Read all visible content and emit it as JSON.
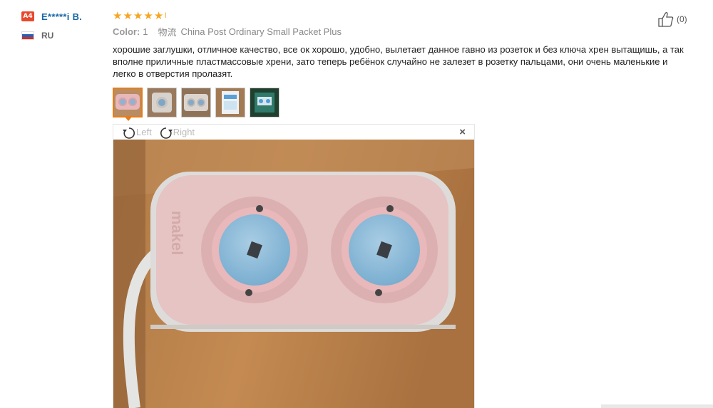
{
  "user": {
    "level_badge": "A4",
    "name": "E*****i B.",
    "country_code": "RU"
  },
  "rating": {
    "stars": 5,
    "max": 5
  },
  "info": {
    "color_label": "Color:",
    "color_value": "1",
    "shipping_label": "物流",
    "shipping_value": "China Post Ordinary Small Packet Plus"
  },
  "review": {
    "text": "хорошие заглушки, отличное качество, все ок хорошо, удобно, вылетает данное гавно из розеток и без ключа хрен вытащишь, а так вполне приличные пластмассовые хрени, зато теперь ребёнок случайно не залезет в розетку пальцами, они очень маленькие и легко в отверстия пролазят."
  },
  "thumbnails": [
    {
      "name": "thumb-1",
      "active": true
    },
    {
      "name": "thumb-2",
      "active": false
    },
    {
      "name": "thumb-3",
      "active": false
    },
    {
      "name": "thumb-4",
      "active": false
    },
    {
      "name": "thumb-5",
      "active": false
    }
  ],
  "viewer": {
    "rotate_left_label": "Left",
    "rotate_right_label": "Right",
    "close_glyph": "×",
    "photo_logo_text": "makel"
  },
  "helpful": {
    "count_text": "(0)"
  },
  "colors": {
    "accent": "#e67d19",
    "star": "#f5a623",
    "username": "#1967a8",
    "badge": "#e8482d"
  },
  "icons": {
    "rotate_left": "rotate-left-icon",
    "rotate_right": "rotate-right-icon",
    "close": "close-icon",
    "thumbs_up": "thumbs-up-icon",
    "star": "star-icon",
    "flag": "flag-icon"
  }
}
